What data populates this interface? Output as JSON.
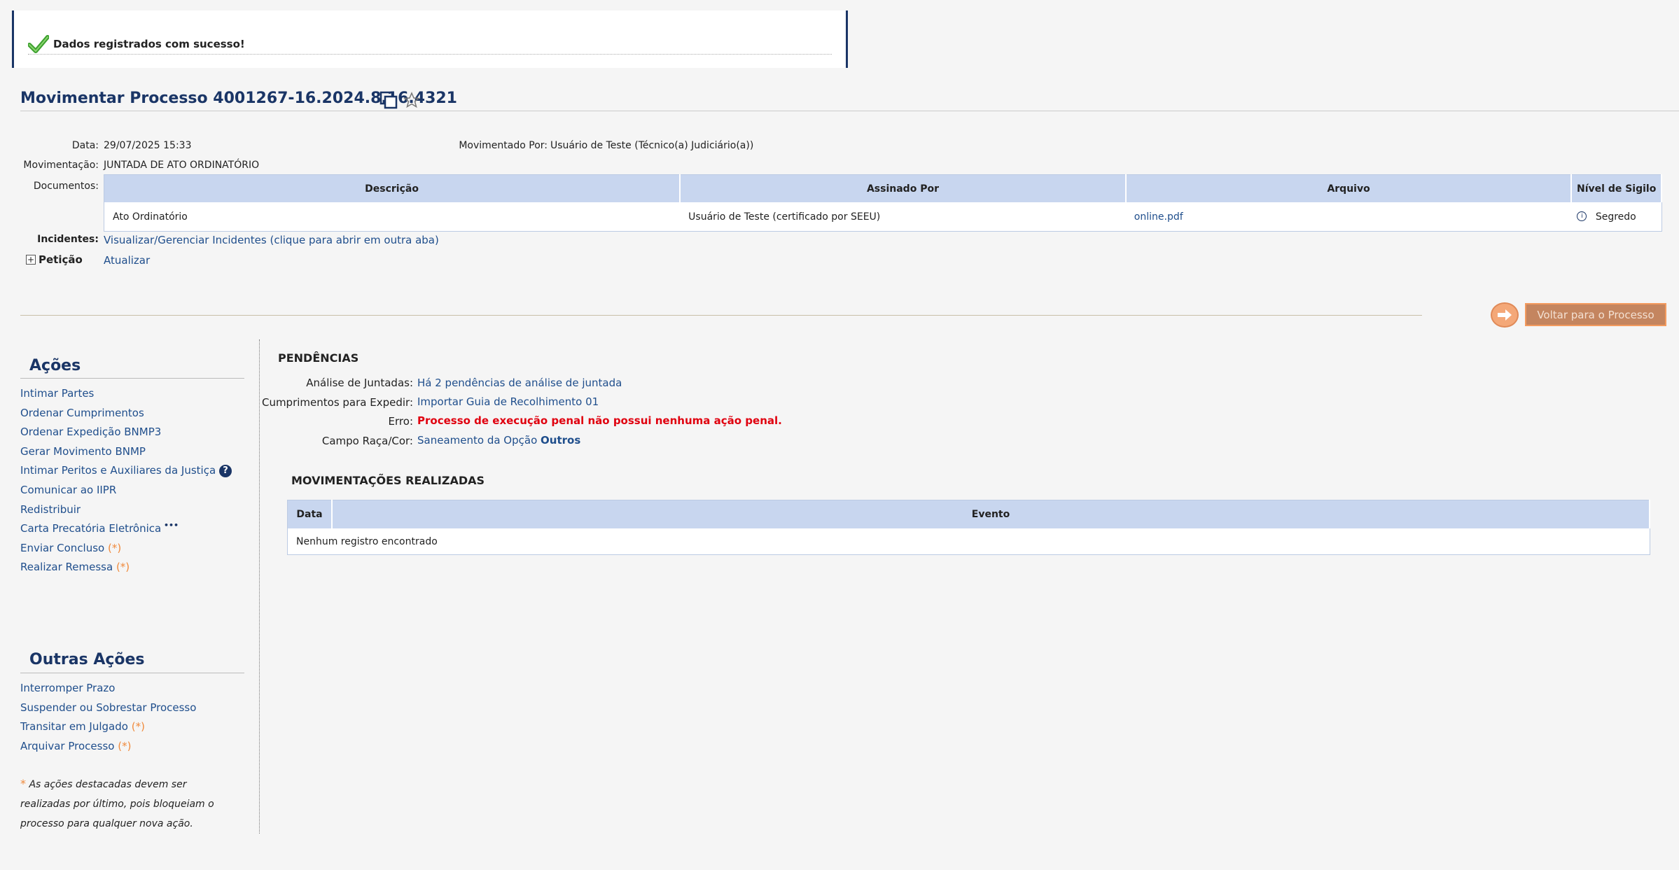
{
  "success": {
    "message": "Dados registrados com sucesso!",
    "icon": "check-icon"
  },
  "header": {
    "title": "Movimentar Processo 4001267-16.2024.8.16.4321"
  },
  "info": {
    "data_label": "Data:",
    "data_value": "29/07/2025 15:33",
    "movimentado_label": "Movimentado Por:",
    "movimentado_value": "Usuário de Teste (Técnico(a) Judiciário(a))",
    "movimentacao_label": "Movimentação:",
    "movimentacao_value": "JUNTADA DE ATO ORDINATÓRIO",
    "documentos_label": "Documentos:",
    "incidentes_label": "Incidentes:",
    "incidentes_link": "Visualizar/Gerenciar Incidentes (clique para abrir em outra aba)",
    "peticao_label": "Petição",
    "peticao_link": "Atualizar"
  },
  "documents": {
    "columns": [
      "Descrição",
      "Assinado Por",
      "Arquivo",
      "Nível de Sigilo"
    ],
    "rows": [
      {
        "descricao": "Ato Ordinatório",
        "assinado": "Usuário de Teste (certificado por SEEU)",
        "arquivo": "online.pdf",
        "sigilo": "Segredo"
      }
    ]
  },
  "back_button": {
    "label": "Voltar para o Processo"
  },
  "acoes": {
    "title": "Ações",
    "items": [
      "Intimar Partes",
      "Ordenar Cumprimentos",
      "Ordenar Expedição BNMP3",
      "Gerar Movimento BNMP",
      "Intimar Peritos e Auxiliares da Justiça",
      "Comunicar ao IIPR",
      "Redistribuir",
      "Carta Precatória Eletrônica",
      "Enviar Concluso",
      "Realizar Remessa"
    ],
    "star": "(*)",
    "more": "•••"
  },
  "outras_acoes": {
    "title": "Outras Ações",
    "items": [
      "Interromper Prazo",
      "Suspender ou Sobrestar Processo",
      "Transitar em Julgado",
      "Arquivar Processo"
    ]
  },
  "footnote": {
    "star": "*",
    "text": "As ações destacadas devem ser realizadas por último, pois bloqueiam o processo para qualquer nova ação."
  },
  "pendencias": {
    "title": "PENDÊNCIAS",
    "analise_label": "Análise de Juntadas:",
    "analise_value": "Há 2 pendências de análise de juntada",
    "cumprimentos_label": "Cumprimentos para Expedir:",
    "cumprimentos_value": "Importar Guia de Recolhimento 01",
    "erro_label": "Erro:",
    "erro_value": "Processo de execução penal não possui nenhuma ação penal.",
    "campo_label": "Campo Raça/Cor:",
    "campo_value": "Saneamento da Opção",
    "campo_bold": "Outros"
  },
  "movimentacoes": {
    "title": "MOVIMENTAÇÕES REALIZADAS",
    "columns": [
      "Data",
      "Evento"
    ],
    "empty": "Nenhum registro encontrado"
  },
  "colors": {
    "link": "#1f4e8c",
    "error": "#e0000f",
    "accent": "#f39a5e",
    "header_bg": "#c8d6ef"
  }
}
